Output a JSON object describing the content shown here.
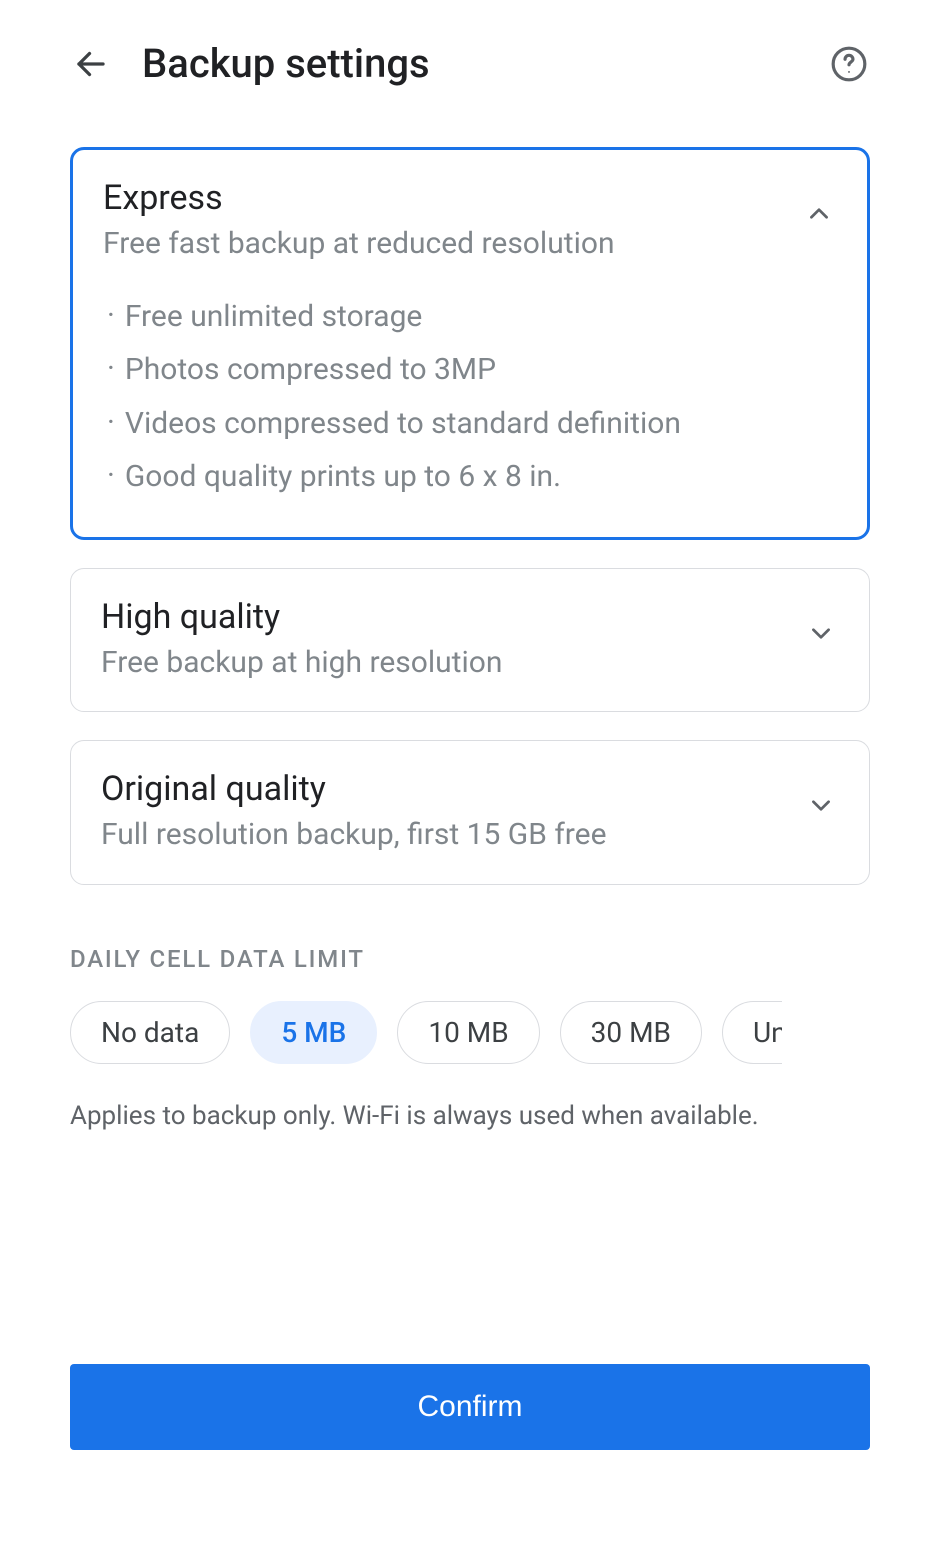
{
  "header": {
    "title": "Backup settings"
  },
  "options": {
    "express": {
      "title": "Express",
      "subtitle": "Free fast backup at reduced resolution",
      "bullets": [
        "Free unlimited storage",
        "Photos compressed to 3MP",
        "Videos compressed to standard definition",
        "Good quality prints up to 6 x 8 in."
      ]
    },
    "high": {
      "title": "High quality",
      "subtitle": "Free backup at high resolution"
    },
    "original": {
      "title": "Original quality",
      "subtitle": "Full resolution backup, first 15 GB free"
    }
  },
  "dataLimit": {
    "label": "DAILY CELL DATA LIMIT",
    "chips": [
      "No data",
      "5 MB",
      "10 MB",
      "30 MB",
      "Unl"
    ],
    "helper": "Applies to backup only. Wi-Fi is always used when available."
  },
  "confirm": {
    "label": "Confirm"
  }
}
